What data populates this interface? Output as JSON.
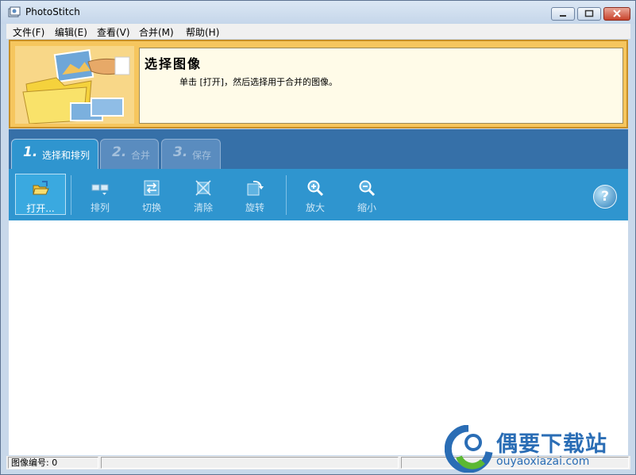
{
  "window": {
    "title": "PhotoStitch",
    "icon": "photostitch-app-icon",
    "controls": [
      "minimize-icon",
      "maximize-icon",
      "close-icon"
    ]
  },
  "menu": {
    "items": [
      "文件(F)",
      "编辑(E)",
      "查看(V)",
      "合并(M)",
      "帮助(H)"
    ]
  },
  "header": {
    "title": "选择图像",
    "description": "单击 [打开]，然后选择用于合并的图像。"
  },
  "tabs": [
    {
      "number": "1.",
      "label": "选择和排列",
      "active": true
    },
    {
      "number": "2.",
      "label": "合并",
      "active": false
    },
    {
      "number": "3.",
      "label": "保存",
      "active": false
    }
  ],
  "toolbar": {
    "buttons": [
      {
        "label": "打开...",
        "icon": "open-folder-icon",
        "active": true
      },
      {
        "label": "排列",
        "icon": "arrange-icon"
      },
      {
        "label": "切换",
        "icon": "swap-icon"
      },
      {
        "label": "清除",
        "icon": "clear-icon"
      },
      {
        "label": "旋转",
        "icon": "rotate-icon"
      },
      {
        "label": "放大",
        "icon": "zoom-in-icon"
      },
      {
        "label": "缩小",
        "icon": "zoom-out-icon"
      }
    ],
    "help_label": "?"
  },
  "status": {
    "image_count": "图像编号: 0"
  },
  "watermark": {
    "title": "偶要下载站",
    "url": "ouyaoxiazai.com"
  },
  "colors": {
    "toolbar_blue": "#2f95cf",
    "tabstrip_blue": "#3670a8",
    "header_orange": "#f6c65e",
    "watermark_blue": "#2a6db5"
  }
}
